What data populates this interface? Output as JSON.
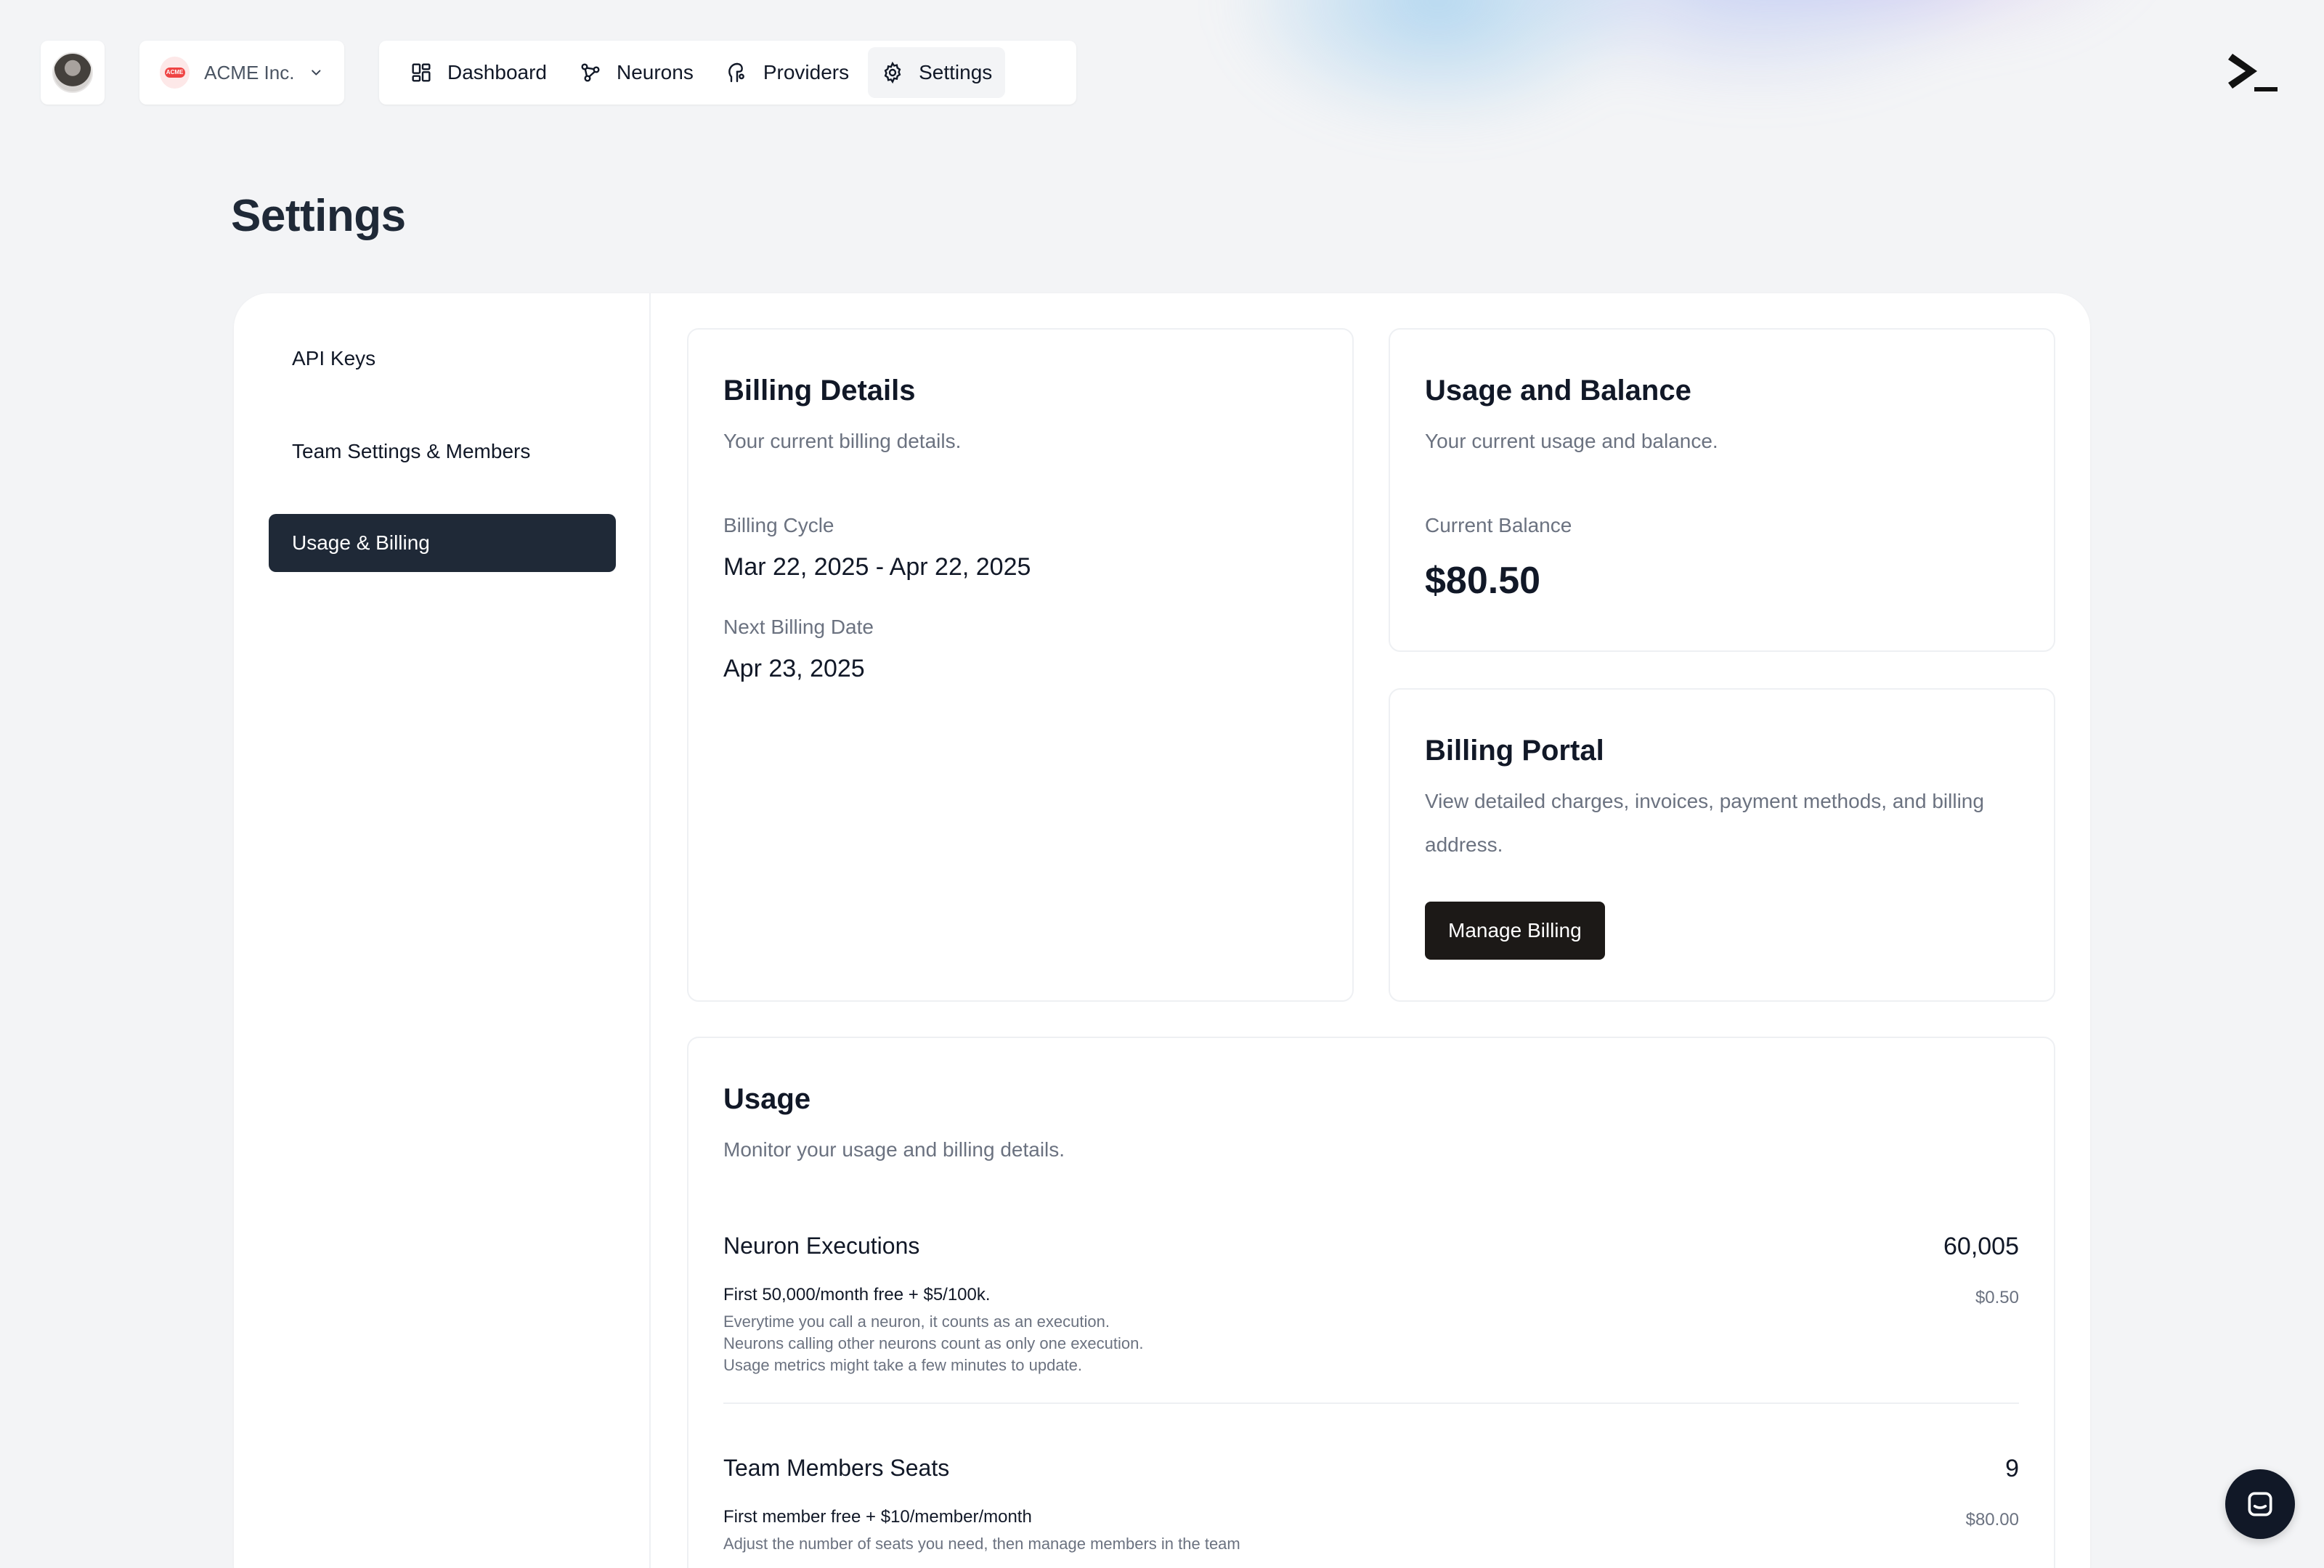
{
  "org": {
    "name": "ACME Inc.",
    "logo_text": "ACME"
  },
  "nav": {
    "items": [
      {
        "label": "Dashboard",
        "icon": "dashboard-icon"
      },
      {
        "label": "Neurons",
        "icon": "neurons-icon"
      },
      {
        "label": "Providers",
        "icon": "providers-icon"
      },
      {
        "label": "Settings",
        "icon": "gear-icon",
        "active": true
      }
    ]
  },
  "page": {
    "title": "Settings"
  },
  "sidebar": {
    "items": [
      {
        "label": "API Keys"
      },
      {
        "label": "Team Settings & Members"
      },
      {
        "label": "Usage & Billing",
        "active": true
      }
    ]
  },
  "billing_details": {
    "title": "Billing Details",
    "subtitle": "Your current billing details.",
    "cycle_label": "Billing Cycle",
    "cycle_value": "Mar 22, 2025 - Apr 22, 2025",
    "next_label": "Next Billing Date",
    "next_value": "Apr 23, 2025"
  },
  "usage_balance": {
    "title": "Usage and Balance",
    "subtitle": "Your current usage and balance.",
    "balance_label": "Current Balance",
    "balance_value": "$80.50"
  },
  "billing_portal": {
    "title": "Billing Portal",
    "desc_line1": "View detailed charges, invoices, payment methods, and billing",
    "desc_line2": "address.",
    "button": "Manage Billing"
  },
  "usage": {
    "title": "Usage",
    "subtitle": "Monitor your usage and billing details.",
    "rows": [
      {
        "name": "Neuron Executions",
        "count": "60,005",
        "rule": "First 50,000/month free + $5/100k.",
        "cost": "$0.50",
        "desc": [
          "Everytime you call a neuron, it counts as an execution.",
          "Neurons calling other neurons count as only one execution.",
          "Usage metrics might take a few minutes to update."
        ]
      },
      {
        "name": "Team Members Seats",
        "count": "9",
        "rule": "First member free + $10/member/month",
        "cost": "$80.00",
        "desc": [
          "Adjust the number of seats you need, then manage members in the team"
        ]
      }
    ]
  },
  "colors": {
    "primary_dark": "#1f2937",
    "button_dark": "#1c1917",
    "muted_text": "#6b7280",
    "background": "#f3f4f6"
  }
}
